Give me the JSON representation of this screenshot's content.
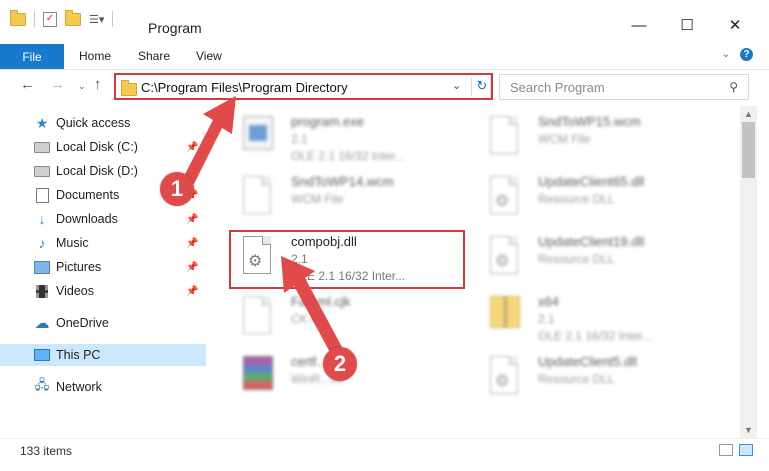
{
  "window": {
    "title": "Program",
    "minimize_glyph": "—",
    "maximize_glyph": "☐",
    "close_glyph": "✕"
  },
  "ribbon": {
    "file": "File",
    "tabs": [
      "Home",
      "Share",
      "View"
    ],
    "help_glyph": "?"
  },
  "address_bar": {
    "path": "C:\\Program Files\\Program Directory"
  },
  "search": {
    "placeholder": "Search Program"
  },
  "sidebar": {
    "items": [
      {
        "label": "Quick access",
        "icon": "star-icon"
      },
      {
        "label": "Local Disk (C:)",
        "icon": "drive-icon"
      },
      {
        "label": "Local Disk (D:)",
        "icon": "drive-icon"
      },
      {
        "label": "Documents",
        "icon": "documents-icon"
      },
      {
        "label": "Downloads",
        "icon": "download-icon"
      },
      {
        "label": "Music",
        "icon": "music-icon"
      },
      {
        "label": "Pictures",
        "icon": "pictures-icon"
      },
      {
        "label": "Videos",
        "icon": "videos-icon"
      },
      {
        "label": "OneDrive",
        "icon": "cloud-icon"
      },
      {
        "label": "This PC",
        "icon": "computer-icon"
      },
      {
        "label": "Network",
        "icon": "network-icon"
      }
    ]
  },
  "files": [
    {
      "name": "program.exe",
      "line2": "2.1",
      "line3": "OLE 2.1 16/32 Inter...",
      "icon": "exe"
    },
    {
      "name": "SndToWP15.wcm",
      "line2": "WCM File",
      "line3": "",
      "icon": "file"
    },
    {
      "name": "SndToWP14.wcm",
      "line2": "WCM File",
      "line3": "",
      "icon": "file"
    },
    {
      "name": "UpdateClient65.dll",
      "line2": "Resource DLL",
      "line3": "",
      "icon": "dll"
    },
    {
      "name": "compobj.dll",
      "line2": "2.1",
      "line3": "OLE 2.1 16/32 Inter...",
      "icon": "dll"
    },
    {
      "name": "UpdateClient19.dll",
      "line2": "Resource DLL",
      "line3": "",
      "icon": "dll"
    },
    {
      "name": "Fa...ml.cjk",
      "line2": "CK F...",
      "line3": "",
      "icon": "file"
    },
    {
      "name": "x64",
      "line2": "2.1",
      "line3": "OLE 2.1 16/32 Inter...",
      "icon": "zipfolder"
    },
    {
      "name": "certf...ab",
      "line2": "WinR...ve",
      "line3": "",
      "icon": "rar"
    },
    {
      "name": "UpdateClient5.dll",
      "line2": "Resource DLL",
      "line3": "",
      "icon": "dll"
    }
  ],
  "annotations": {
    "step1": "1",
    "step2": "2",
    "color": "#e04a4a"
  },
  "status": {
    "item_count": "133 items"
  }
}
